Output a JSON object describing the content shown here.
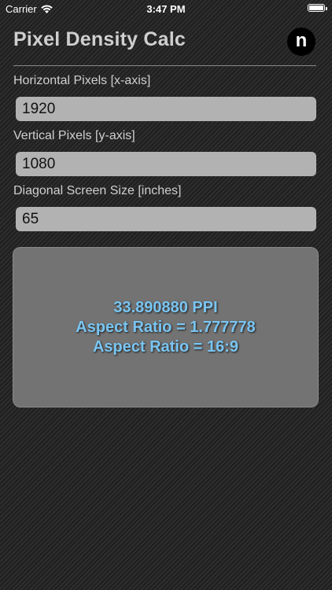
{
  "status_bar": {
    "carrier": "Carrier",
    "time": "3:47 PM"
  },
  "header": {
    "title": "Pixel Density Calc",
    "logo_letter": "n"
  },
  "fields": {
    "horizontal": {
      "label": "Horizontal Pixels  [x-axis]",
      "value": "1920"
    },
    "vertical": {
      "label": "Vertical Pixels [y-axis]",
      "value": "1080"
    },
    "diagonal": {
      "label": "Diagonal Screen Size [inches]",
      "value": "65"
    }
  },
  "result": {
    "ppi": "33.890880 PPI",
    "aspect_decimal": "Aspect Ratio = 1.777778",
    "aspect_ratio": "Aspect Ratio = 16:9"
  },
  "colors": {
    "result_text": "#79c5f2",
    "panel": "#737373",
    "input_bg": "#b2b2b2"
  }
}
